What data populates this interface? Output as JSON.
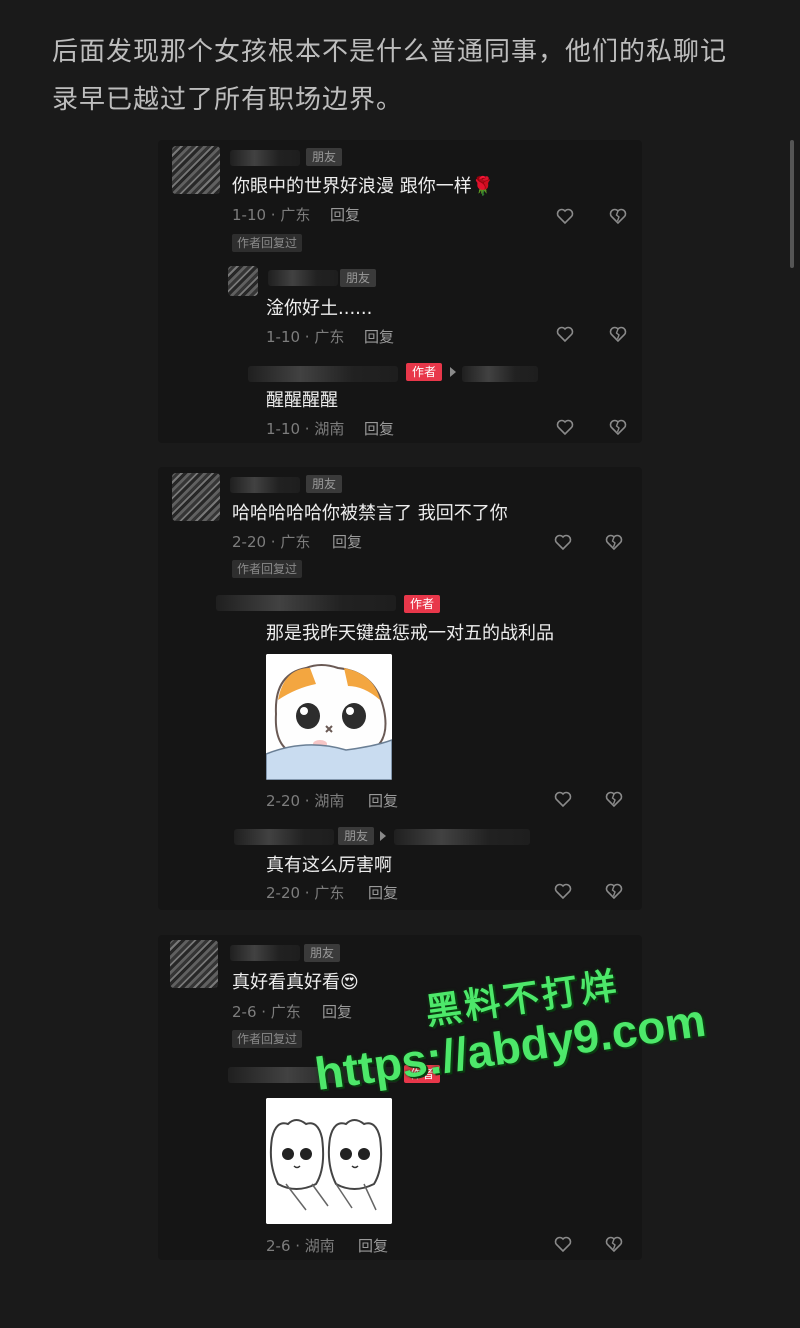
{
  "intro": "后面发现那个女孩根本不是什么普通同事，他们的私聊记录早已越过了所有职场边界。",
  "labels": {
    "friend": "朋友",
    "author": "作者",
    "author_replied": "作者回复过",
    "reply": "回复"
  },
  "card1": {
    "main": {
      "text": "你眼中的世界好浪漫  跟你一样🌹",
      "meta": "1-10 · 广东"
    },
    "reply1": {
      "text": "淦你好土......",
      "meta": "1-10 · 广东"
    },
    "reply2": {
      "text": "醒醒醒醒",
      "meta": "1-10 · 湖南"
    }
  },
  "card2": {
    "main": {
      "text": "哈哈哈哈哈你被禁言了 我回不了你",
      "meta": "2-20 · 广东"
    },
    "reply1": {
      "text": "那是我昨天键盘惩戒一对五的战利品",
      "meta": "2-20 · 湖南"
    },
    "reply2": {
      "text": "真有这么厉害啊",
      "meta": "2-20 · 广东"
    }
  },
  "card3": {
    "main": {
      "text": "真好看真好看😍",
      "meta": "2-6 · 广东"
    },
    "reply1": {
      "meta": "2-6 · 湖南"
    }
  },
  "watermark": {
    "title": "黑料不打烊",
    "url": "https://abdy9.com"
  },
  "colors": {
    "background": "#1a1a1a",
    "card": "#151515",
    "author_tag": "#e8374a",
    "watermark": "#4de86a"
  },
  "icons": [
    "heart-icon",
    "broken-heart-icon",
    "play-arrow-icon"
  ]
}
